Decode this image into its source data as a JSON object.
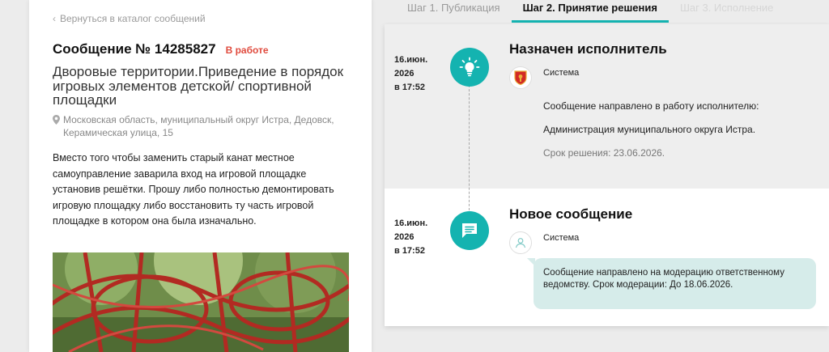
{
  "left": {
    "back_label": "Вернуться в каталог сообщений",
    "title": "Сообщение № 14285827",
    "status": "В работе",
    "category": "Дворовые территории.Приведение в порядок игровых элементов детской/ спортивной площадки",
    "address": "Московская область, муниципальный округ Истра, Дедовск, Керамическая улица, 15",
    "description": "Вместо того чтобы заменить старый канат местное самоуправление заварила вход на игровой площадке установив решётки. Прошу либо полностью демонтировать игровую площадку либо восстановить ту часть игровой площадке в котором она была изначально."
  },
  "tabs": [
    {
      "label": "Шаг 1. Публикация",
      "state": "normal"
    },
    {
      "label": "Шаг 2. Принятие решения",
      "state": "active"
    },
    {
      "label": "Шаг 3. Исполнение",
      "state": "disabled"
    }
  ],
  "events": [
    {
      "date": "16.июн.",
      "year": "2026",
      "time": "в 17:52",
      "icon": "lightbulb-icon",
      "title": "Назначен исполнитель",
      "author": "Система",
      "lines": [
        "Сообщение направлено в работу исполнителю:",
        "Администрация муниципального округа Истра.",
        "Срок решения: 23.06.2026."
      ]
    },
    {
      "date": "16.июн.",
      "year": "2026",
      "time": "в 17:52",
      "icon": "chat-icon",
      "title": "Новое сообщение",
      "author": "Система",
      "bubble": "Сообщение направлено на модерацию ответственному ведомству. Срок модерации: До 18.06.2026."
    }
  ],
  "colors": {
    "accent": "#14b3b0",
    "status": "#e04b3e",
    "bubble": "#d6ecea"
  }
}
